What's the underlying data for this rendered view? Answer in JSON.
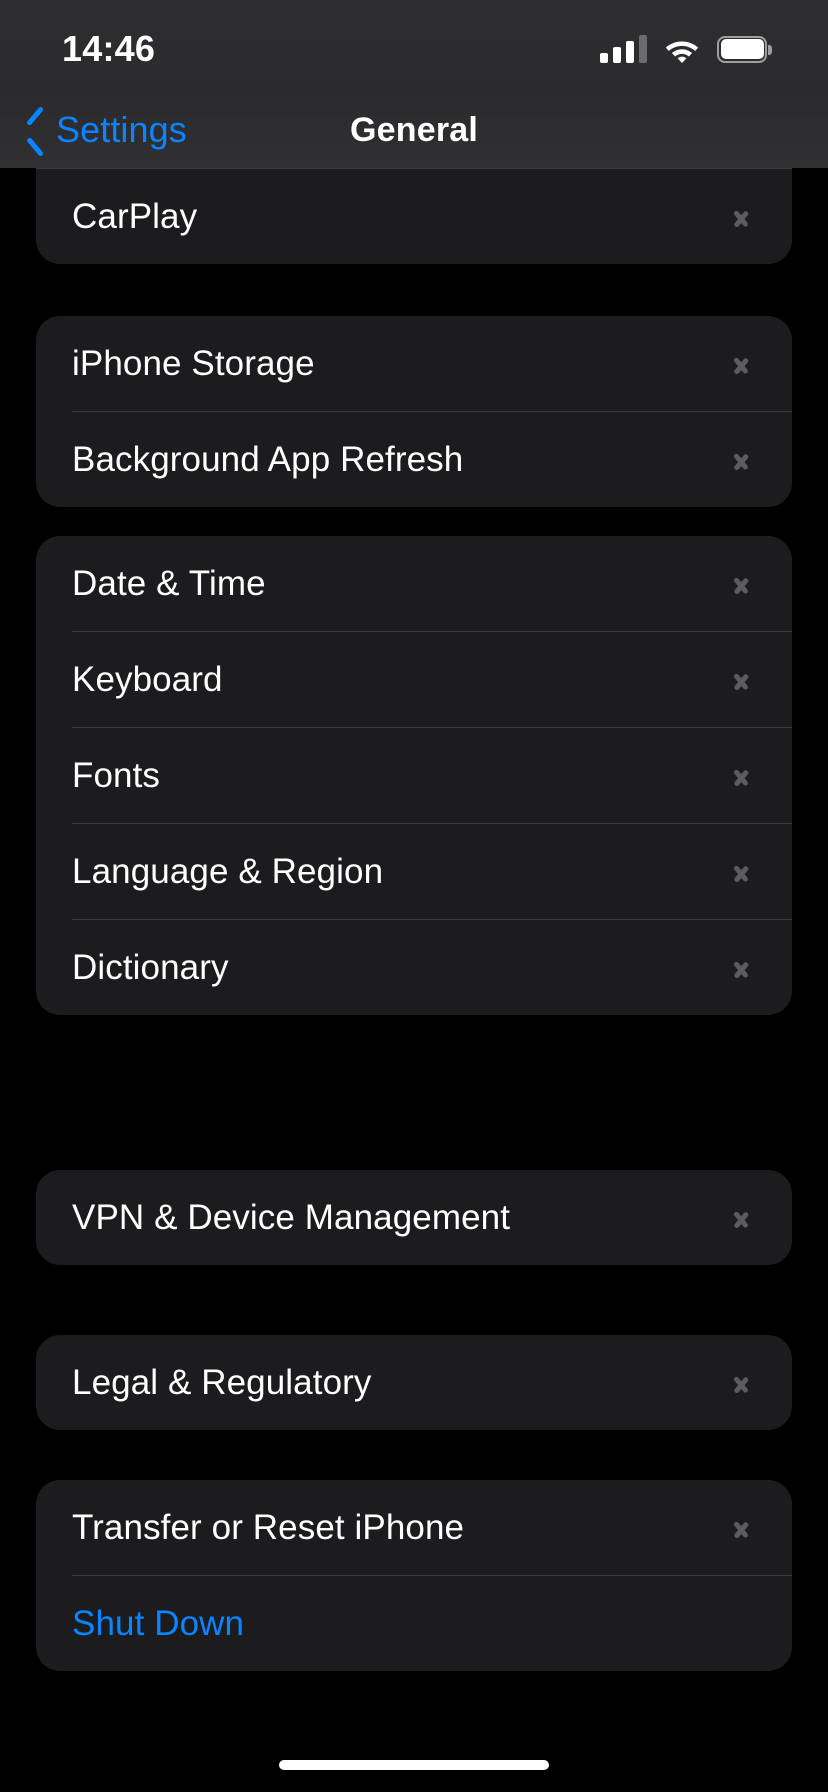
{
  "status_bar": {
    "time": "14:46",
    "signal_icon": "cellular-signal-icon",
    "signal_bars_filled": 3,
    "signal_bars_total": 4,
    "wifi_icon": "wifi-icon",
    "battery_icon": "battery-icon",
    "battery_level_full": true
  },
  "nav_bar": {
    "back_label": "Settings",
    "back_icon": "chevron-left-icon",
    "title": "General"
  },
  "colors": {
    "accent": "#0a84ff",
    "page_background": "#000000",
    "card_background": "#1c1c1e",
    "separator": "#38383a",
    "chevron": "#5c5c60",
    "nav_background": "#2b2b2d"
  },
  "groups": [
    {
      "id": "group-carplay",
      "clipped_top": true,
      "rows": [
        {
          "label": "CarPlay",
          "name": "row-carplay",
          "chevron": true,
          "accent": false
        }
      ]
    },
    {
      "id": "group-storage",
      "clipped_top": false,
      "rows": [
        {
          "label": "iPhone Storage",
          "name": "row-iphone-storage",
          "chevron": true,
          "accent": false
        },
        {
          "label": "Background App Refresh",
          "name": "row-background-app-refresh",
          "chevron": true,
          "accent": false
        }
      ]
    },
    {
      "id": "group-localization",
      "clipped_top": false,
      "rows": [
        {
          "label": "Date & Time",
          "name": "row-date-and-time",
          "chevron": true,
          "accent": false
        },
        {
          "label": "Keyboard",
          "name": "row-keyboard",
          "chevron": true,
          "accent": false
        },
        {
          "label": "Fonts",
          "name": "row-fonts",
          "chevron": true,
          "accent": false
        },
        {
          "label": "Language & Region",
          "name": "row-language-and-region",
          "chevron": true,
          "accent": false
        },
        {
          "label": "Dictionary",
          "name": "row-dictionary",
          "chevron": true,
          "accent": false
        }
      ]
    },
    {
      "id": "group-vpn",
      "clipped_top": false,
      "rows": [
        {
          "label": "VPN & Device Management",
          "name": "row-vpn-device-management",
          "chevron": true,
          "accent": false
        }
      ]
    },
    {
      "id": "group-legal",
      "clipped_top": false,
      "rows": [
        {
          "label": "Legal & Regulatory",
          "name": "row-legal-and-regulatory",
          "chevron": true,
          "accent": false
        }
      ]
    },
    {
      "id": "group-reset",
      "clipped_top": false,
      "rows": [
        {
          "label": "Transfer or Reset iPhone",
          "name": "row-transfer-or-reset-iphone",
          "chevron": true,
          "accent": false
        },
        {
          "label": "Shut Down",
          "name": "row-shut-down",
          "chevron": false,
          "accent": true
        }
      ]
    }
  ],
  "home_indicator": {
    "name": "home-indicator"
  }
}
